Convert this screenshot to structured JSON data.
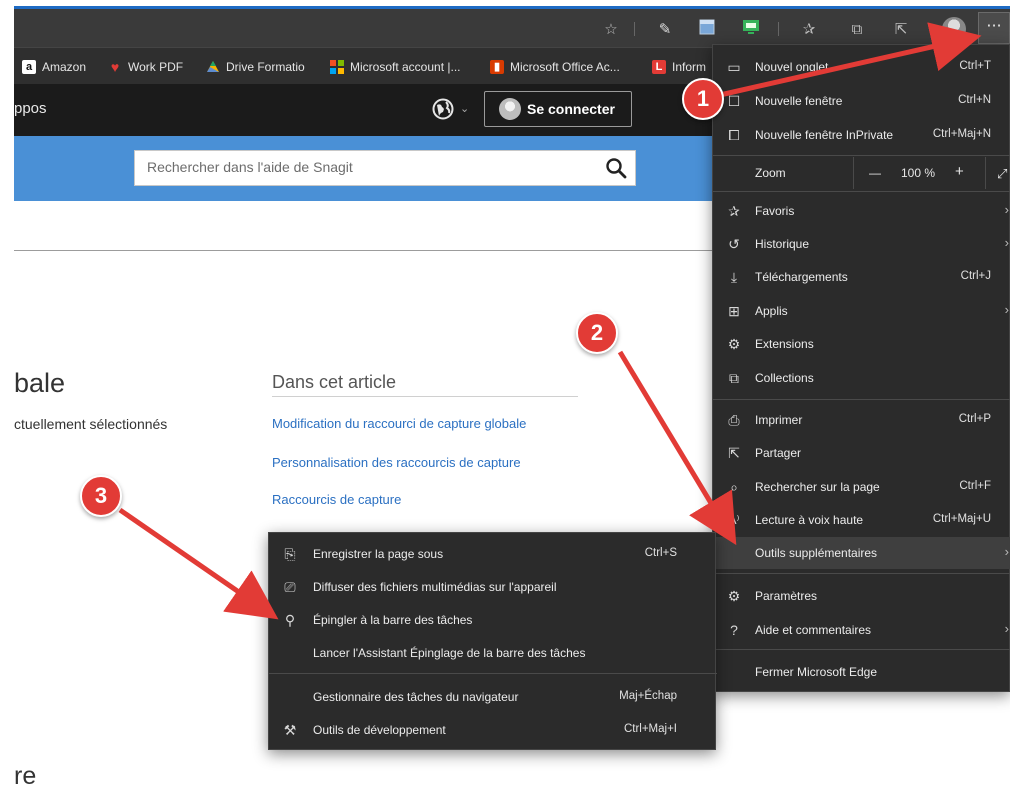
{
  "toolbar": {
    "icons": [
      "star-icon",
      "pen-icon",
      "window-icon",
      "screenshot-icon",
      "favorites-icon",
      "collections-icon",
      "share-icon",
      "profile-avatar",
      "more-icon"
    ],
    "more_label": "···"
  },
  "favorites": [
    {
      "label": "Amazon",
      "icon": "amazon-icon",
      "color": "#ffffff"
    },
    {
      "label": "Work PDF",
      "icon": "heart-icon",
      "color": "#e23b36"
    },
    {
      "label": "Drive Formatio",
      "icon": "drive-icon",
      "color": "#f5b400"
    },
    {
      "label": "Microsoft account |...",
      "icon": "microsoft-icon",
      "color": "#f25022"
    },
    {
      "label": "Microsoft Office Ac...",
      "icon": "office-icon",
      "color": "#d83b01"
    },
    {
      "label": "Inform",
      "icon": "l-icon",
      "color": "#e23b36"
    }
  ],
  "site": {
    "nav_text": "ppos",
    "signin_label": "Se connecter",
    "search_placeholder": "Rechercher dans l'aide de Snagit"
  },
  "page": {
    "heading": "bale",
    "subtext": "ctuellement sélectionnés",
    "article_title": "Dans cet article",
    "links": [
      "Modification du raccourci de capture globale",
      "Personnalisation des raccourcis de capture",
      "Raccourcis de capture"
    ],
    "heading_bottom": "re"
  },
  "main_menu": {
    "items": [
      {
        "label": "Nouvel onglet",
        "shortcut": "Ctrl+T",
        "icon": "new-tab-icon"
      },
      {
        "label": "Nouvelle fenêtre",
        "shortcut": "Ctrl+N",
        "icon": "new-window-icon"
      },
      {
        "label": "Nouvelle fenêtre InPrivate",
        "shortcut": "Ctrl+Maj+N",
        "icon": "inprivate-icon"
      },
      {
        "label": "Favoris",
        "shortcut": "",
        "icon": "favorites-icon"
      },
      {
        "label": "Historique",
        "shortcut": "",
        "icon": "history-icon"
      },
      {
        "label": "Téléchargements",
        "shortcut": "Ctrl+J",
        "icon": "download-icon"
      },
      {
        "label": "Applis",
        "shortcut": "",
        "icon": "apps-icon"
      },
      {
        "label": "Extensions",
        "shortcut": "",
        "icon": "extensions-icon"
      },
      {
        "label": "Collections",
        "shortcut": "",
        "icon": "collections-icon"
      },
      {
        "label": "Imprimer",
        "shortcut": "Ctrl+P",
        "icon": "print-icon"
      },
      {
        "label": "Partager",
        "shortcut": "",
        "icon": "share-icon"
      },
      {
        "label": "Rechercher sur la page",
        "shortcut": "Ctrl+F",
        "icon": "find-icon"
      },
      {
        "label": "Lecture à voix haute",
        "shortcut": "Ctrl+Maj+U",
        "icon": "read-aloud-icon"
      },
      {
        "label": "Outils supplémentaires",
        "shortcut": "",
        "icon": ""
      },
      {
        "label": "Paramètres",
        "shortcut": "",
        "icon": "settings-icon"
      },
      {
        "label": "Aide et commentaires",
        "shortcut": "",
        "icon": "help-icon"
      },
      {
        "label": "Fermer Microsoft Edge",
        "shortcut": "",
        "icon": ""
      }
    ],
    "zoom": {
      "label": "Zoom",
      "minus": "—",
      "value": "100 %",
      "plus": "+"
    }
  },
  "sub_menu": {
    "items": [
      {
        "label": "Enregistrer la page sous",
        "shortcut": "Ctrl+S",
        "icon": "save-page-icon"
      },
      {
        "label": "Diffuser des fichiers multimédias sur l'appareil",
        "shortcut": "",
        "icon": "cast-icon"
      },
      {
        "label": "Épingler à la barre des tâches",
        "shortcut": "",
        "icon": "pin-icon"
      },
      {
        "label": "Lancer l'Assistant Épinglage de la barre des tâches",
        "shortcut": "",
        "icon": ""
      },
      {
        "label": "Gestionnaire des tâches du navigateur",
        "shortcut": "Maj+Échap",
        "icon": ""
      },
      {
        "label": "Outils de développement",
        "shortcut": "Ctrl+Maj+I",
        "icon": "devtools-icon"
      }
    ]
  },
  "annotations": {
    "badges": [
      "1",
      "2",
      "3"
    ],
    "color": "#e23b36"
  }
}
